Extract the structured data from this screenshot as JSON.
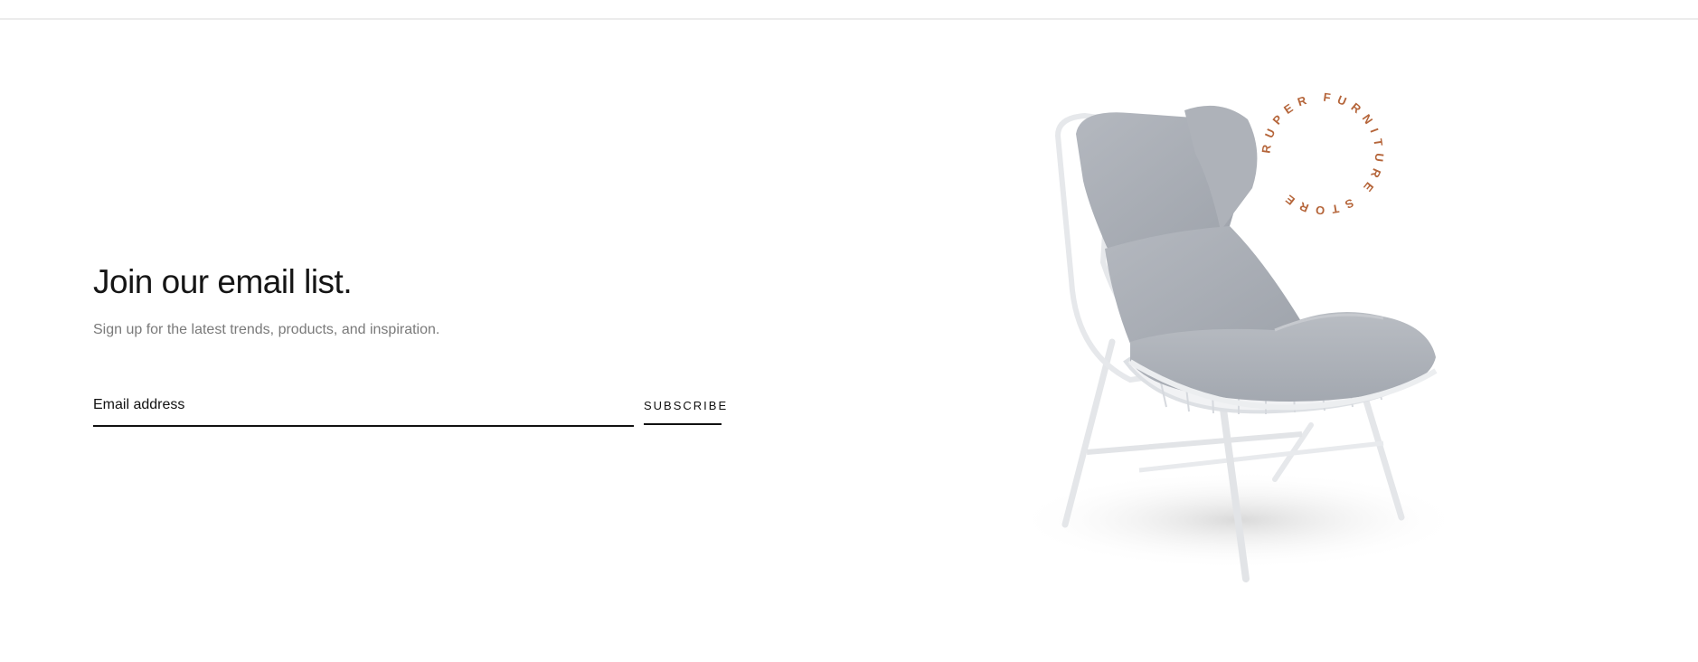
{
  "newsletter": {
    "heading": "Join our email list.",
    "subtext": "Sign up for the latest trends, products, and inspiration.",
    "email_placeholder": "Email address",
    "subscribe_label": "SUBSCRIBE"
  },
  "badge": {
    "text": "RUPER FURNITURE STORE",
    "color": "#b5653a"
  },
  "image": {
    "subject": "armchair"
  }
}
